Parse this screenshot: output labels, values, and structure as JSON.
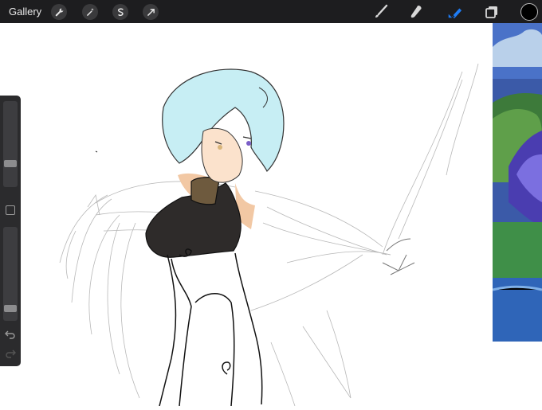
{
  "toolbar": {
    "gallery_label": "Gallery",
    "left_tools": [
      "wrench-icon",
      "magic-wand-icon",
      "selection-icon",
      "transform-icon"
    ],
    "right_tools": [
      "brush-icon",
      "smudge-icon",
      "eraser-icon",
      "layers-icon",
      "color-well"
    ],
    "active_tool": "eraser",
    "current_color": "#000000",
    "accent_color": "#1e7cf5"
  },
  "sidebar": {
    "brush_size_level": 0.25,
    "opacity_level": 0.1,
    "icons": [
      "modify-square-icon",
      "undo-icon",
      "redo-icon"
    ]
  },
  "canvas": {
    "background": "#ffffff",
    "reference_image": "fantasy-landscape-reference"
  }
}
